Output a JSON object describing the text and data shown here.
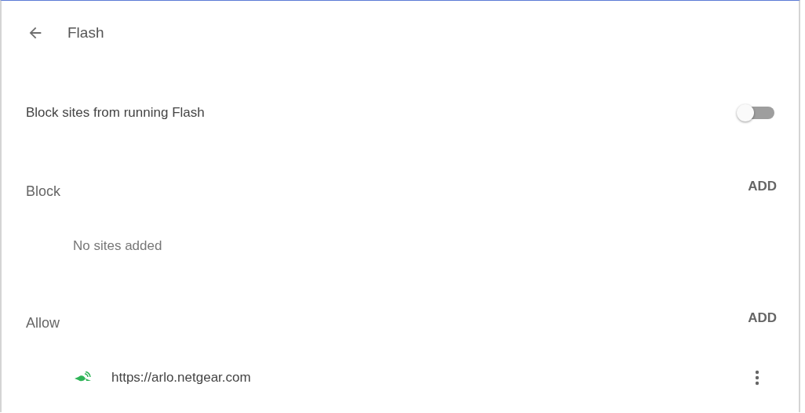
{
  "header": {
    "title": "Flash"
  },
  "setting": {
    "label": "Block sites from running Flash",
    "on": false
  },
  "sections": [
    {
      "title": "Block",
      "action": "ADD",
      "empty_text": "No sites added"
    },
    {
      "title": "Allow",
      "action": "ADD",
      "sites": [
        {
          "url": "https://arlo.netgear.com"
        }
      ]
    }
  ]
}
